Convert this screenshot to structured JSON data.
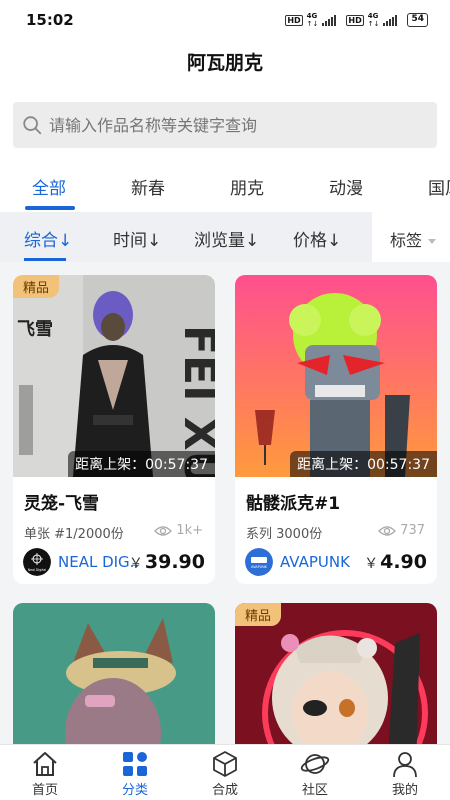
{
  "status_bar": {
    "time": "15:02",
    "net1": "4G",
    "net2": "4G",
    "battery": "54",
    "hd": "HD"
  },
  "page_title": "阿瓦朋克",
  "search": {
    "placeholder": "请输入作品名称等关键字查询"
  },
  "category_tabs": [
    {
      "label": "全部",
      "active": true
    },
    {
      "label": "新春"
    },
    {
      "label": "朋克"
    },
    {
      "label": "动漫"
    },
    {
      "label": "国风"
    }
  ],
  "sort_options": [
    {
      "label": "综合↓",
      "active": true
    },
    {
      "label": "时间↓"
    },
    {
      "label": "浏览量↓"
    },
    {
      "label": "价格↓"
    }
  ],
  "tag_filter": "标签",
  "cards": [
    {
      "badge": "精品",
      "countdown": "距离上架：00:57:37",
      "title": "灵笼-飞雪",
      "subtitle": "单张 #1/2000份",
      "views": "1k+",
      "creator": "NEAL DIG...",
      "avatar_text": "Neal Digital",
      "currency": "￥",
      "price": "39.90",
      "art_text": {
        "big": "FEI XUE",
        "cn": "飞雪"
      }
    },
    {
      "badge": "",
      "countdown": "距离上架：00:57:37",
      "title": "骷髅派克#1",
      "subtitle": "系列 3000份",
      "views": "737",
      "creator": "AVAPUNK",
      "avatar_text": "AVAPUNK",
      "currency": "￥",
      "price": "4.90"
    },
    {
      "badge": ""
    },
    {
      "badge": "精品"
    }
  ],
  "tabbar": [
    {
      "label": "首页",
      "icon": "home-icon"
    },
    {
      "label": "分类",
      "icon": "category-icon",
      "active": true
    },
    {
      "label": "合成",
      "icon": "cube-icon"
    },
    {
      "label": "社区",
      "icon": "planet-icon"
    },
    {
      "label": "我的",
      "icon": "user-icon"
    }
  ],
  "colors": {
    "accent": "#1a66d9",
    "badge": "#f2c27a",
    "background": "#f3f4f6"
  }
}
